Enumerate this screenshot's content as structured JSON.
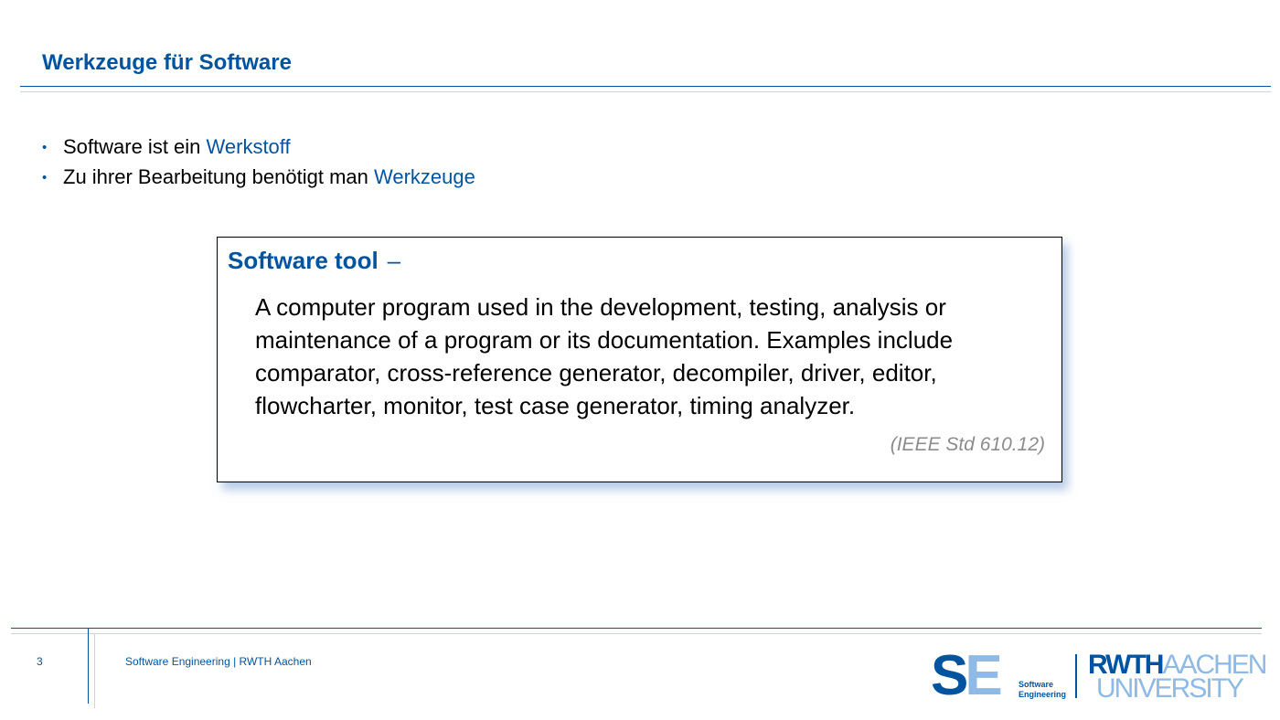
{
  "slide": {
    "title": "Werkzeuge für Software",
    "bullets": [
      {
        "text": "Software ist ein ",
        "highlight": "Werkstoff"
      },
      {
        "text": "Zu ihrer Bearbeitung benötigt man ",
        "highlight": "Werkzeuge"
      }
    ],
    "bullet_glyph": "•"
  },
  "definition": {
    "term": "Software tool",
    "dash": "–",
    "lines": [
      "A computer program used in the development, testing, analysis or",
      "maintenance of a program or its documentation. Examples include",
      "comparator, cross-reference generator, decompiler, driver, editor,",
      "flowcharter, monitor, test case generator, timing analyzer."
    ],
    "source": "(IEEE Std 610.12)"
  },
  "footer": {
    "page_number": "3",
    "text": "Software Engineering  |  RWTH Aachen"
  },
  "logos": {
    "se": {
      "s": "S",
      "e": "E",
      "line1": "Software",
      "line2": "Engineering"
    },
    "rwth": {
      "part1": "RWTH",
      "part2": "AACHEN",
      "line2": "UNIVERSITY"
    }
  },
  "colors": {
    "accent": "#00549f",
    "light_accent": "#8ebae5",
    "source_gray": "#8c8c8c"
  }
}
